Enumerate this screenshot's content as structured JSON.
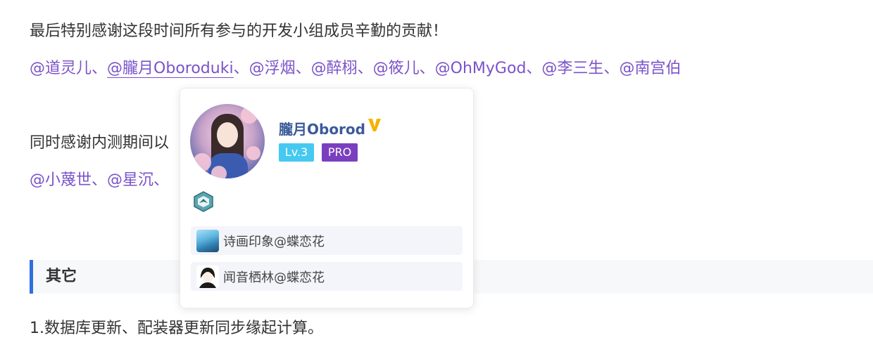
{
  "thanks_line": "最后特别感谢这段时间所有参与的开发小组成员辛勤的贡献！",
  "dev_mentions": [
    "@道灵儿",
    "@朧月Oboroduki",
    "@浮烟",
    "@醉栩",
    "@筱儿",
    "@OhMyGod",
    "@李三生",
    "@南宫伯"
  ],
  "separator": "、",
  "beta_line": "同时感谢内测期间以",
  "beta_mentions": [
    "@小蔑世",
    "@星沉"
  ],
  "section_title": "其它",
  "item_line": "1.数据库更新、配装器更新同步缘起计算。",
  "colors": {
    "mention": "#7b52c9",
    "section_bar": "#2f6fde",
    "lv_badge": "#45c9f0",
    "pro_badge": "#7a3fbf",
    "username": "#3b5a9a"
  },
  "card": {
    "username": "朧月Oborod",
    "verified_icon": "verified-v-icon",
    "level": "Lv.3",
    "pro": "PRO",
    "medal_icon": "medal-icon",
    "guilds": [
      {
        "name": "诗画印象@蝶恋花",
        "icon": "guild-landscape-icon"
      },
      {
        "name": "闻音栖林@蝶恋花",
        "icon": "guild-character-icon"
      }
    ]
  }
}
